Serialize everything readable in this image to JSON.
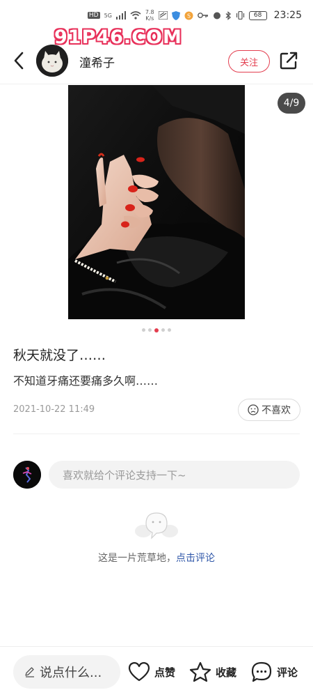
{
  "status_bar": {
    "network_labels": [
      "HD",
      "5G"
    ],
    "speed_value": "7.8",
    "speed_unit": "K/s",
    "battery": "68",
    "time": "23:25"
  },
  "watermark": "91P46.COM",
  "header": {
    "username": "潼希子",
    "follow_label": "关注"
  },
  "post": {
    "image_counter": "4/9",
    "image_total": 9,
    "image_current": 4,
    "title": "秋天就没了……",
    "body": "不知道牙痛还要痛多久啊……",
    "date": "2021-10-22 11:49",
    "dislike_label": "不喜欢"
  },
  "comment": {
    "placeholder": "喜欢就给个评论支持一下~"
  },
  "empty_state": {
    "text": "这是一片荒草地，",
    "link": "点击评论"
  },
  "bottom_bar": {
    "say_label": "说点什么...",
    "like_label": "点赞",
    "collect_label": "收藏",
    "comment_label": "评论"
  },
  "colors": {
    "accent": "#e33d4e",
    "link": "#2e56a8",
    "input_bg": "#f3f3f3"
  }
}
